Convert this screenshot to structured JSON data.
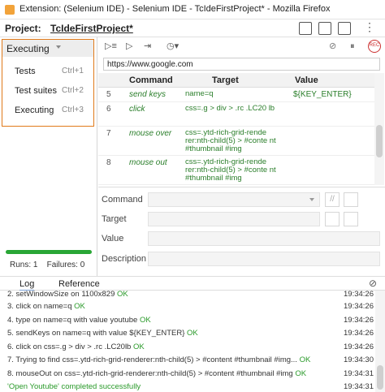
{
  "window": {
    "title": "Extension: (Selenium IDE) - Selenium IDE - TcIdeFirstProject* - Mozilla Firefox"
  },
  "project": {
    "label": "Project:",
    "name": "TcIdeFirstProject*"
  },
  "sidebar": {
    "selected": "Executing",
    "menu": [
      {
        "label": "Tests",
        "shortcut": "Ctrl+1"
      },
      {
        "label": "Test suites",
        "shortcut": "Ctrl+2"
      },
      {
        "label": "Executing",
        "shortcut": "Ctrl+3"
      }
    ],
    "progress": 1.0,
    "runs": "Runs: 1",
    "failures": "Failures: 0"
  },
  "toolbar": {
    "url": "https://www.google.com",
    "record": "REC"
  },
  "grid": {
    "headers": [
      "Command",
      "Target",
      "Value"
    ],
    "rows": [
      {
        "num": "5",
        "command": "send keys",
        "target": "name=q",
        "value": "${KEY_ENTER}"
      },
      {
        "num": "6",
        "command": "click",
        "target": "css=.g > div > .rc .LC20 lb",
        "value": ""
      },
      {
        "num": "7",
        "command": "mouse over",
        "target": "css=.ytd-rich-grid-rende rer:nth-child(5) > #conte nt #thumbnail #img",
        "value": ""
      },
      {
        "num": "8",
        "command": "mouse out",
        "target": "css=.ytd-rich-grid-rende rer:nth-child(5) > #conte nt #thumbnail #img",
        "value": ""
      }
    ]
  },
  "editor": {
    "command_label": "Command",
    "target_label": "Target",
    "value_label": "Value",
    "description_label": "Description",
    "comment_button": "//"
  },
  "log": {
    "tabs": [
      "Log",
      "Reference"
    ],
    "entries": [
      {
        "text": "2.  setWindowSize on 1100x829",
        "status": "OK",
        "time": "19:34:26"
      },
      {
        "text": "3.  click on name=q",
        "status": "OK",
        "time": "19:34:26"
      },
      {
        "text": "4.  type on name=q with value youtube",
        "status": "OK",
        "time": "19:34:26"
      },
      {
        "text": "5.  sendKeys on name=q with value ${KEY_ENTER}",
        "status": "OK",
        "time": "19:34:26"
      },
      {
        "text": "6.  click on css=.g > div > .rc .LC20lb",
        "status": "OK",
        "time": "19:34:26"
      },
      {
        "text": "7.  Trying to find css=.ytd-rich-grid-renderer:nth-child(5) > #content #thumbnail #img...",
        "status": "OK",
        "time": "19:34:30"
      },
      {
        "text": "8.  mouseOut on css=.ytd-rich-grid-renderer:nth-child(5) > #content #thumbnail #img",
        "status": "OK",
        "time": "19:34:31"
      }
    ],
    "final": {
      "text": "'Open Youtube' completed successfully",
      "time": "19:34:31"
    }
  }
}
